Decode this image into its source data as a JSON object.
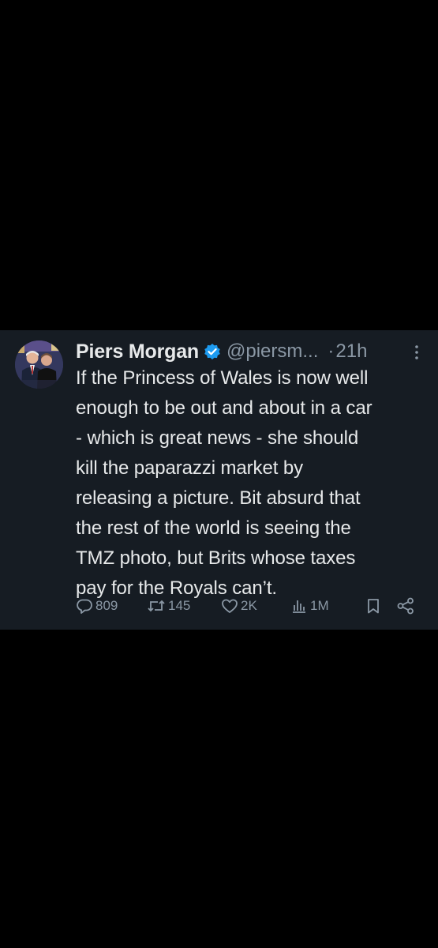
{
  "tweet": {
    "author_name": "Piers Morgan",
    "handle": "@piersm...",
    "separator": "·",
    "time": "21h",
    "text_lines": [
      "If the Princess of Wales is now well",
      "enough to be out and about in a car",
      "- which is great news - she should",
      "kill the paparazzi market by",
      "releasing a picture. Bit absurd that",
      "the rest of the world is seeing the",
      "TMZ photo, but Brits whose taxes",
      "pay for the Royals can’t."
    ],
    "stats": {
      "replies": "809",
      "reposts": "145",
      "likes": "2K",
      "views": "1M"
    }
  },
  "colors": {
    "background": "#000000",
    "card": "#161c23",
    "text": "#e7e9ea",
    "muted": "#8b98a5",
    "verified": "#1d9bf0"
  },
  "icons": {
    "avatar": "avatar-photo",
    "verified": "verified-badge-icon",
    "more": "more-options-icon",
    "reply": "reply-icon",
    "repost": "repost-icon",
    "like": "heart-icon",
    "views": "views-icon",
    "bookmark": "bookmark-icon",
    "share": "share-icon"
  }
}
